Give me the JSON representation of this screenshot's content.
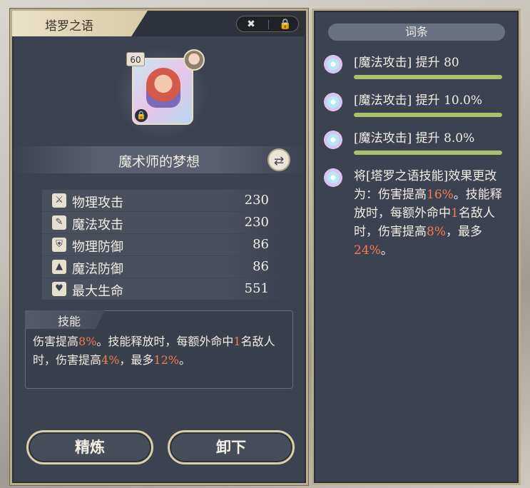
{
  "left_panel": {
    "title": "塔罗之语",
    "card": {
      "level": "60"
    },
    "item_name": "魔术师的梦想",
    "stats": [
      {
        "icon": "sword-icon",
        "glyph": "⚔",
        "label": "物理攻击",
        "value": "230"
      },
      {
        "icon": "wand-icon",
        "glyph": "✎",
        "label": "魔法攻击",
        "value": "230"
      },
      {
        "icon": "shield-icon",
        "glyph": "⛨",
        "label": "物理防御",
        "value": "86"
      },
      {
        "icon": "hat-icon",
        "glyph": "▲",
        "label": "魔法防御",
        "value": "86"
      },
      {
        "icon": "heart-icon",
        "glyph": "♥",
        "label": "最大生命",
        "value": "551"
      }
    ],
    "skill": {
      "tab_label": "技能",
      "segments": [
        {
          "t": "伤害提高",
          "hl": false
        },
        {
          "t": "8%",
          "hl": true
        },
        {
          "t": "。技能释放时，每额外命中",
          "hl": false
        },
        {
          "t": "1",
          "hl": true
        },
        {
          "t": "名敌人时，伤害提高",
          "hl": false
        },
        {
          "t": "4%",
          "hl": true
        },
        {
          "t": "，最多",
          "hl": false
        },
        {
          "t": "12%",
          "hl": true
        },
        {
          "t": "。",
          "hl": false
        }
      ]
    },
    "buttons": {
      "refine": "精炼",
      "unequip": "卸下"
    }
  },
  "right_panel": {
    "header": "词条",
    "affixes": [
      {
        "text": "[魔法攻击] 提升 80",
        "fill": 1.0
      },
      {
        "text": "[魔法攻击] 提升 10.0%",
        "fill": 1.0
      },
      {
        "text": "[魔法攻击] 提升 8.0%",
        "fill": 1.0
      }
    ],
    "effect": {
      "segments": [
        {
          "t": "将[塔罗之语技能]效果更改为：伤害提高",
          "hl": false
        },
        {
          "t": "16%",
          "hl": true
        },
        {
          "t": "。技能释放时，每额外命中",
          "hl": false
        },
        {
          "t": "1",
          "hl": true
        },
        {
          "t": "名敌人时，伤害提高",
          "hl": false
        },
        {
          "t": "8%",
          "hl": true
        },
        {
          "t": "，最多",
          "hl": false
        },
        {
          "t": "24%",
          "hl": true
        },
        {
          "t": "。",
          "hl": false
        }
      ]
    }
  },
  "colors": {
    "highlight": "#ef7d55",
    "bar_fill": "#a9c26a",
    "panel_bg": "#3d4250",
    "border": "#b9ad8c"
  }
}
